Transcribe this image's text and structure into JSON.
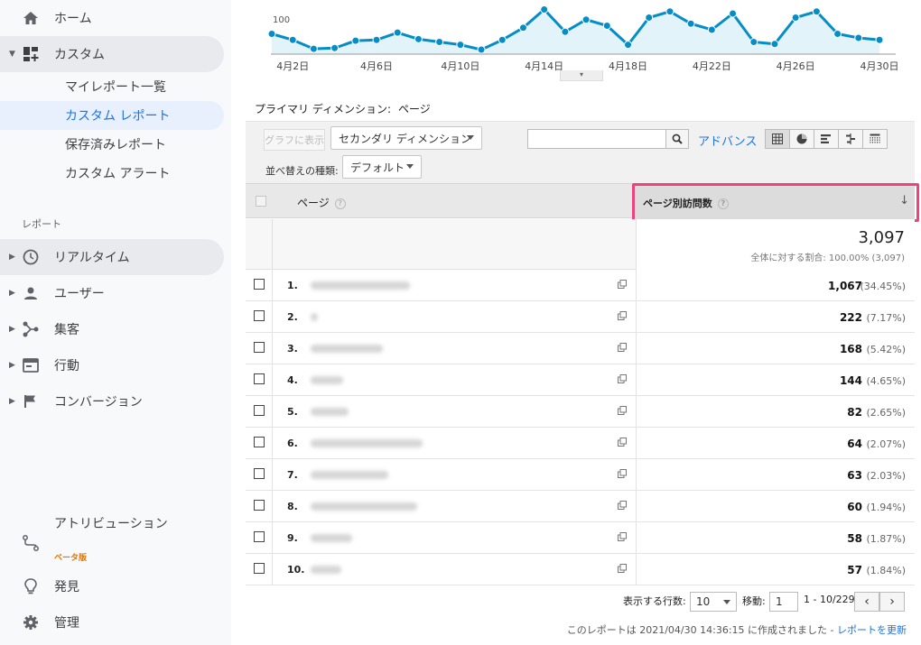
{
  "sidebar": {
    "home": "ホーム",
    "custom": "カスタム",
    "sub_items": [
      "マイレポート一覧",
      "カスタム レポート",
      "保存済みレポート",
      "カスタム アラート"
    ],
    "section_label": "レポート",
    "reports": [
      "リアルタイム",
      "ユーザー",
      "集客",
      "行動",
      "コンバージョン"
    ],
    "attribution": "アトリビューション",
    "beta": "ベータ版",
    "discover": "発見",
    "admin": "管理"
  },
  "chart": {
    "y_tick_label": "100",
    "x_tick_labels": [
      "4月2日",
      "4月6日",
      "4月10日",
      "4月14日",
      "4月18日",
      "4月22日",
      "4月26日",
      "4月30日"
    ],
    "series_values": [
      125,
      110,
      88,
      90,
      108,
      110,
      128,
      112,
      105,
      98,
      86,
      110,
      140,
      185,
      130,
      160,
      145,
      98,
      165,
      180,
      150,
      135,
      175,
      105,
      100,
      165,
      180,
      125,
      115,
      110
    ],
    "line_color": "#058dc7",
    "fill_color": "#e3f3fa"
  },
  "dimension": {
    "label": "プライマリ ディメンション:",
    "value": "ページ"
  },
  "toolbar": {
    "graph_button": "グラフに表示",
    "secondary_dimension": "セカンダリ ディメンション",
    "search_placeholder": "",
    "advance_link": "アドバンス",
    "sort_label": "並べ替えの種類:",
    "sort_value": "デフォルト"
  },
  "table": {
    "col_page": "ページ",
    "col_metric": "ページ別訪問数",
    "total_value": "3,097",
    "total_sub": "全体に対する割合: 100.00% (3,097)",
    "rows": [
      {
        "idx": "1.",
        "value": "1,067",
        "pct": "(34.45%)",
        "blur_w": 110
      },
      {
        "idx": "2.",
        "value": "222",
        "pct": "(7.17%)",
        "blur_w": 8
      },
      {
        "idx": "3.",
        "value": "168",
        "pct": "(5.42%)",
        "blur_w": 80
      },
      {
        "idx": "4.",
        "value": "144",
        "pct": "(4.65%)",
        "blur_w": 36
      },
      {
        "idx": "5.",
        "value": "82",
        "pct": "(2.65%)",
        "blur_w": 42
      },
      {
        "idx": "6.",
        "value": "64",
        "pct": "(2.07%)",
        "blur_w": 124
      },
      {
        "idx": "7.",
        "value": "63",
        "pct": "(2.03%)",
        "blur_w": 86
      },
      {
        "idx": "8.",
        "value": "60",
        "pct": "(1.94%)",
        "blur_w": 118
      },
      {
        "idx": "9.",
        "value": "58",
        "pct": "(1.87%)",
        "blur_w": 46
      },
      {
        "idx": "10.",
        "value": "57",
        "pct": "(1.84%)",
        "blur_w": 34
      }
    ]
  },
  "pagination": {
    "rows_label": "表示する行数:",
    "rows_value": "10",
    "goto_label": "移動:",
    "goto_value": "1",
    "range": "1 - 10/229"
  },
  "footer": {
    "note": "このレポートは 2021/04/30 14:36:15 に作成されました - ",
    "refresh_link": "レポートを更新"
  },
  "colors": {
    "highlight": "#f0417a",
    "link": "#1a73e8"
  }
}
